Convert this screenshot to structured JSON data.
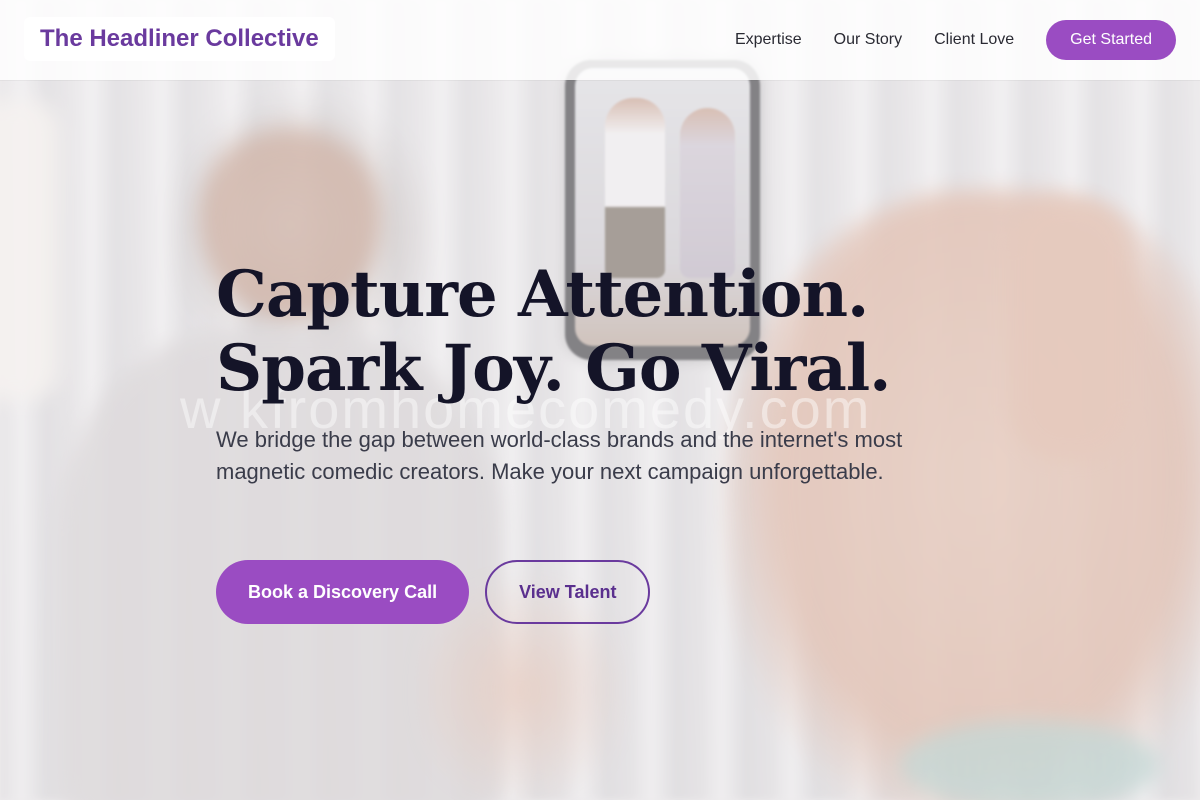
{
  "header": {
    "logo_text": "The Headliner Collective",
    "nav": [
      {
        "label": "Expertise"
      },
      {
        "label": "Our Story"
      },
      {
        "label": "Client Love"
      }
    ],
    "cta_label": "Get Started"
  },
  "hero": {
    "title_line1": "Capture Attention.",
    "title_line2": "Spark Joy. Go Viral.",
    "subtitle": "We bridge the gap between world-class brands and the internet's most magnetic comedic creators. Make your next campaign unforgettable.",
    "primary_button": "Book a Discovery Call",
    "secondary_button": "View Talent",
    "watermark": "w     kfromhomecomedy.com"
  },
  "colors": {
    "brand_purple": "#9a4cc2",
    "logo_purple": "#6a3a9e",
    "heading_dark": "#141428"
  }
}
